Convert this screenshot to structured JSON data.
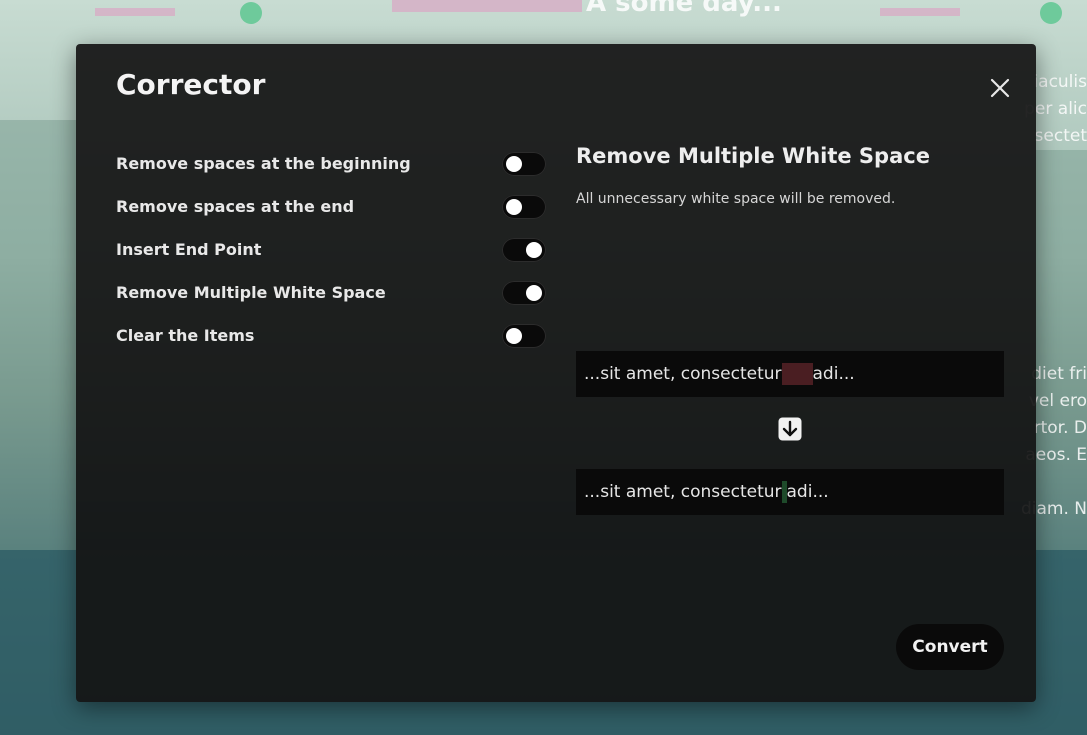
{
  "background": {
    "heading": "A some day...",
    "text_lines": [
      "iaculis",
      "per alic",
      "sectet",
      "diet fri",
      "vel ero",
      "rtor. D",
      "aeos. E",
      "diam. N"
    ]
  },
  "modal": {
    "title": "Corrector",
    "close_icon": "close-icon",
    "options": [
      {
        "label": "Remove spaces at the beginning",
        "enabled": false
      },
      {
        "label": "Remove spaces at the end",
        "enabled": false
      },
      {
        "label": "Insert End Point",
        "enabled": true
      },
      {
        "label": "Remove Multiple White Space",
        "enabled": true
      },
      {
        "label": "Clear the Items",
        "enabled": false
      }
    ],
    "detail": {
      "title": "Remove Multiple White Space",
      "description": "All unnecessary white space will be removed.",
      "example_before_left": "...sit amet, consectetur",
      "example_before_right": "adi...",
      "example_after_left": "...sit amet, consectetur",
      "example_after_right": "adi...",
      "arrow_icon": "arrow-down-icon"
    },
    "convert_label": "Convert"
  },
  "colors": {
    "modal_bg": "#141414",
    "toggle_track": "#0a0a0a",
    "removed_space_highlight": "#4a1e22",
    "kept_space_highlight": "#1e4a2a"
  }
}
